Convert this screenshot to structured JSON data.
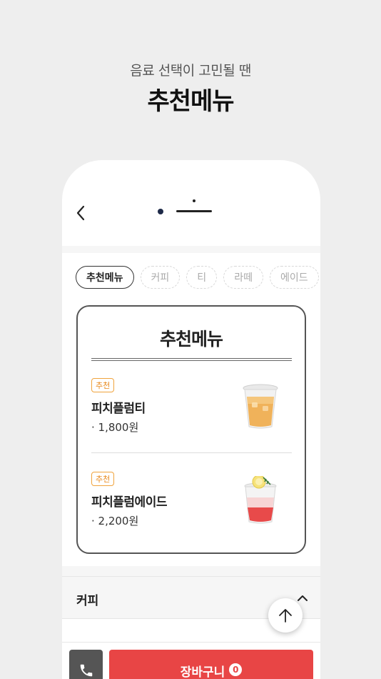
{
  "promo": {
    "subtitle": "음료 선택이 고민될 땐",
    "title": "추천메뉴"
  },
  "header": {
    "back_icon": "chevron-left-icon"
  },
  "categories": [
    {
      "label": "추천메뉴",
      "active": true
    },
    {
      "label": "커피",
      "active": false
    },
    {
      "label": "티",
      "active": false
    },
    {
      "label": "라떼",
      "active": false
    },
    {
      "label": "에이드",
      "active": false
    }
  ],
  "recommend_card": {
    "title": "추천메뉴",
    "items": [
      {
        "badge": "추천",
        "name": "피치플럼티",
        "price": "· 1,800원",
        "image": "peach-plum-tea-drink"
      },
      {
        "badge": "추천",
        "name": "피치플럼에이드",
        "price": "· 2,200원",
        "image": "peach-plum-ade-drink"
      }
    ]
  },
  "section": {
    "label": "커피",
    "chevron_icon": "chevron-up-icon"
  },
  "scroll_top_icon": "arrow-up-icon",
  "bottom_bar": {
    "phone_icon": "phone-icon",
    "cart_label": "장바구니",
    "cart_count": "0"
  },
  "colors": {
    "accent": "#e84545",
    "badge": "#e8891c",
    "background": "#eeeeee"
  }
}
